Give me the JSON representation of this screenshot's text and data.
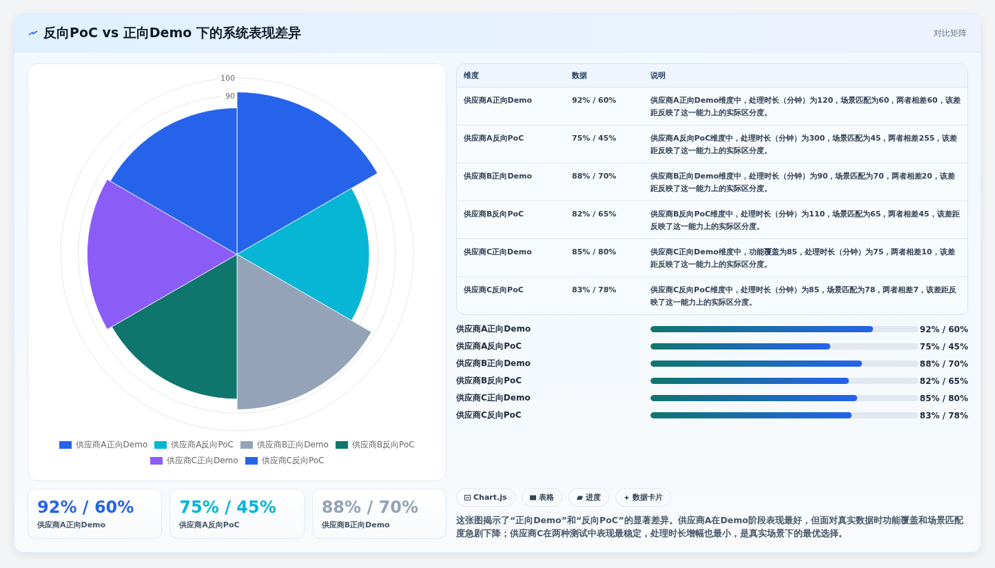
{
  "header": {
    "title": "反向PoC vs 正向Demo 下的系统表现差异",
    "badge": "对比矩阵"
  },
  "chart": {
    "tick_labels": [
      "100",
      "90"
    ],
    "segments": [
      {
        "label": "供应商A正向Demo",
        "color": "#2563eb",
        "level": 0.92
      },
      {
        "label": "供应商A反向PoC",
        "color": "#06b6d4",
        "level": 0.75
      },
      {
        "label": "供应商B正向Demo",
        "color": "#94a3b8",
        "level": 0.88
      },
      {
        "label": "供应商B反向PoC",
        "color": "#0f766e",
        "level": 0.82
      },
      {
        "label": "供应商C正向Demo",
        "color": "#8b5cf6",
        "level": 0.85
      },
      {
        "label": "供应商C反向PoC",
        "color": "#2563eb",
        "level": 0.83
      }
    ]
  },
  "kpis": [
    {
      "value": "92% / 60%",
      "label": "供应商A正向Demo",
      "color": "#2563eb"
    },
    {
      "value": "75% / 45%",
      "label": "供应商A反向PoC",
      "color": "#06b6d4"
    },
    {
      "value": "88% / 70%",
      "label": "供应商B正向Demo",
      "color": "#94a3b8"
    }
  ],
  "table": {
    "columns": [
      "维度",
      "数据",
      "说明"
    ],
    "rows": [
      [
        "供应商A正向Demo",
        "92% / 60%",
        "供应商A正向Demo维度中，处理时长（分钟）为120，场景匹配为60，两者相差60，该差距反映了这一能力上的实际区分度。"
      ],
      [
        "供应商A反向PoC",
        "75% / 45%",
        "供应商A反向PoC维度中，处理时长（分钟）为300，场景匹配为45，两者相差255，该差距反映了这一能力上的实际区分度。"
      ],
      [
        "供应商B正向Demo",
        "88% / 70%",
        "供应商B正向Demo维度中，处理时长（分钟）为90，场景匹配为70，两者相差20，该差距反映了这一能力上的实际区分度。"
      ],
      [
        "供应商B反向PoC",
        "82% / 65%",
        "供应商B反向PoC维度中，处理时长（分钟）为110，场景匹配为65，两者相差45，该差距反映了这一能力上的实际区分度。"
      ],
      [
        "供应商C正向Demo",
        "85% / 80%",
        "供应商C正向Demo维度中，功能覆盖为85，处理时长（分钟）为75，两者相差10，该差距反映了这一能力上的实际区分度。"
      ],
      [
        "供应商C反向PoC",
        "83% / 78%",
        "供应商C反向PoC维度中，处理时长（分钟）为85，场景匹配为78，两者相差7，该差距反映了这一能力上的实际区分度。"
      ]
    ]
  },
  "progress": [
    {
      "label": "供应商A正向Demo",
      "level": 0.83,
      "reading": "92% / 60%"
    },
    {
      "label": "供应商A反向PoC",
      "level": 0.67,
      "reading": "75% / 45%"
    },
    {
      "label": "供应商B正向Demo",
      "level": 0.79,
      "reading": "88% / 70%"
    },
    {
      "label": "供应商B反向PoC",
      "level": 0.74,
      "reading": "82% / 65%"
    },
    {
      "label": "供应商C正向Demo",
      "level": 0.77,
      "reading": "85% / 80%"
    },
    {
      "label": "供应商C反向PoC",
      "level": 0.75,
      "reading": "83% / 78%"
    }
  ],
  "tags": [
    {
      "kind": "chart",
      "label": "Chart.js"
    },
    {
      "kind": "table",
      "label": "表格"
    },
    {
      "kind": "progress",
      "label": "进度"
    },
    {
      "kind": "sparkle",
      "label": "数据卡片"
    }
  ],
  "summary": "这张图揭示了“正向Demo”和“反向PoC”的显著差异。供应商A在Demo阶段表现最好，但面对真实数据时功能覆盖和场景匹配度急剧下降；供应商C在两种测试中表现最稳定，处理时长增幅也最小，是真实场景下的最优选择。"
}
